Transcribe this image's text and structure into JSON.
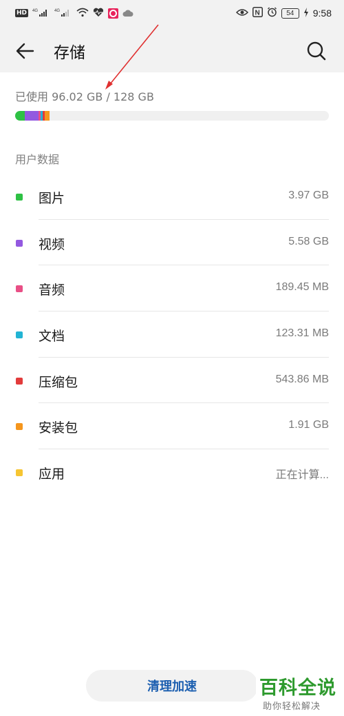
{
  "status_bar": {
    "hd_label": "HD",
    "network_1": "4G",
    "network_2": "4G",
    "nfc_label": "N",
    "battery": "54",
    "time": "9:58"
  },
  "header": {
    "title": "存储"
  },
  "storage": {
    "usage_text": "已使用 96.02 GB / 128 GB",
    "used_gb": 96.02,
    "total_gb": 128,
    "bar_segments": [
      {
        "category": "图片",
        "color": "#2ec144"
      },
      {
        "category": "视频",
        "color": "#9359e0"
      },
      {
        "category": "音频",
        "color": "#e94f86"
      },
      {
        "category": "文档",
        "color": "#22b4d4"
      },
      {
        "category": "压缩包",
        "color": "#e23b3b"
      },
      {
        "category": "安装包",
        "color": "#f5961d"
      }
    ]
  },
  "section": {
    "label": "用户数据"
  },
  "items": [
    {
      "name": "图片",
      "size": "3.97 GB",
      "color": "#2ec144"
    },
    {
      "name": "视频",
      "size": "5.58 GB",
      "color": "#9359e0"
    },
    {
      "name": "音频",
      "size": "189.45 MB",
      "color": "#e94f86"
    },
    {
      "name": "文档",
      "size": "123.31 MB",
      "color": "#22b4d4"
    },
    {
      "name": "压缩包",
      "size": "543.86 MB",
      "color": "#e23b3b"
    },
    {
      "name": "安装包",
      "size": "1.91 GB",
      "color": "#f5961d"
    },
    {
      "name": "应用",
      "size": "正在计算...",
      "color": "#f6c532"
    }
  ],
  "actions": {
    "clean_label": "清理加速"
  },
  "watermark": {
    "title": "百科全说",
    "subtitle": "助你轻松解决"
  },
  "colors": {
    "accent": "#1c5fb0",
    "annotation_arrow": "#e03030",
    "watermark_green": "#2e9a2e"
  }
}
